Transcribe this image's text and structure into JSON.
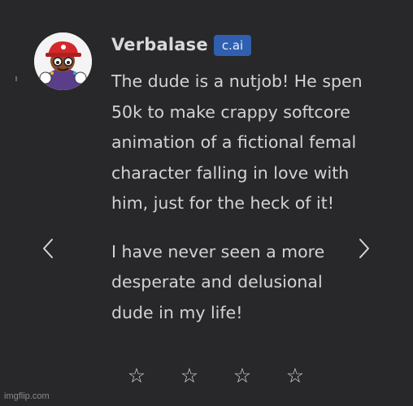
{
  "message_card": {
    "author": "Verbalase",
    "badge": "c.ai",
    "paragraphs": [
      "The dude is a nutjob! He spen\n50k to make crappy softcore\nanimation of a fictional femal\ncharacter falling in love with\nhim, just for the heck of it!",
      "I have never seen a more\ndesperate and delusional\ndude in my life!"
    ]
  },
  "navigation": {
    "prev_icon": "chevron-left-icon",
    "next_icon": "chevron-right-icon"
  },
  "rating": {
    "stars": [
      "☆",
      "☆",
      "☆",
      "☆"
    ],
    "icon": "star-outline-icon"
  },
  "watermark": "imgflip.com",
  "colors": {
    "background": "#28282a",
    "text": "#d3d3d3",
    "badge": "#2f5fae"
  }
}
